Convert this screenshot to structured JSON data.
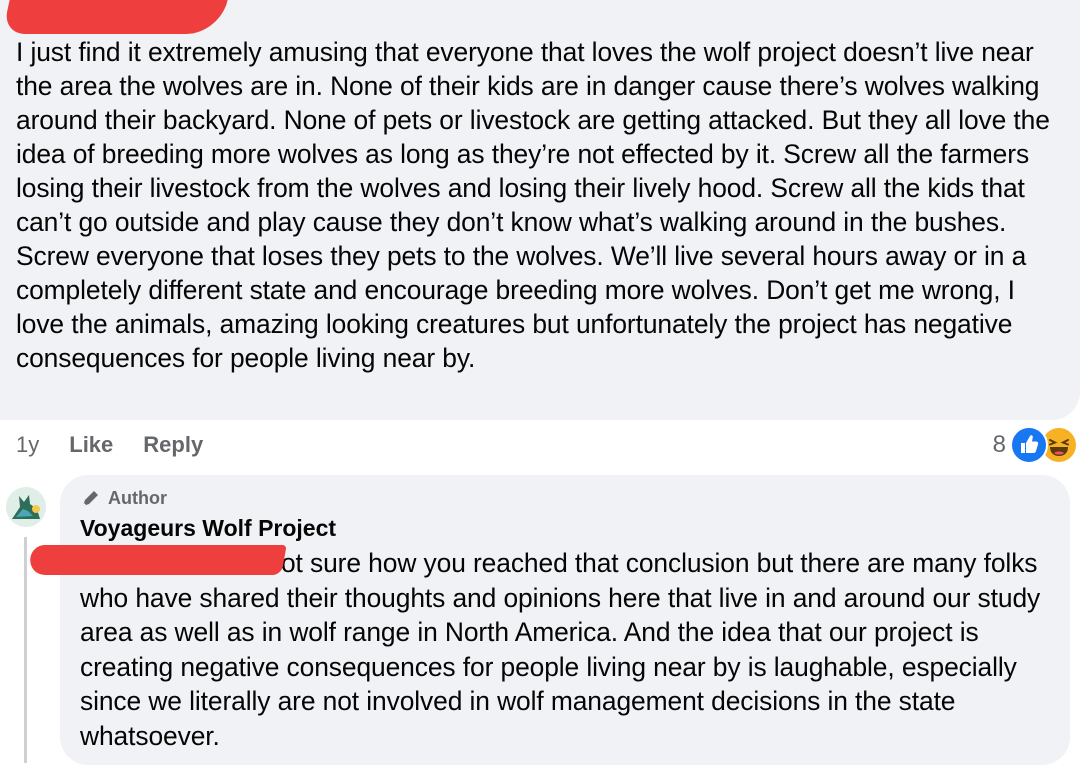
{
  "comment": {
    "text": "I just find it extremely amusing that everyone that loves the wolf project doesn’t live near the area the wolves are in. None of their kids are in danger cause there’s wolves walking around their backyard. None of pets or livestock are getting attacked. But they all love the idea of breeding more wolves as long as they’re not effected by it. Screw all the farmers losing their livestock from the wolves and losing their lively hood. Screw all the kids that can’t go outside and play cause they don’t know what’s walking around in the bushes. Screw everyone that loses they pets to the wolves. We’ll live several hours away or in a completely different state and encourage breeding more wolves. Don’t get me wrong, I love the animals, amazing looking creatures but unfortunately the project has negative consequences for people living near by.",
    "age": "1y",
    "like_label": "Like",
    "reply_label": "Reply",
    "reaction_count": "8",
    "reaction_icons": [
      "like-icon",
      "haha-icon"
    ]
  },
  "reply": {
    "badge": "Author",
    "badge_icon": "pen-icon",
    "author": "Voyageurs Wolf Project",
    "text": "Not sure how you reached that conclusion but there are many folks who have shared their thoughts and opinions here that live in and around our study area as well as in wolf range in North America. And the idea that our project is creating negative consequences for people living near by is laughable, especially since we literally are not involved in wolf management decisions in the state whatsoever."
  },
  "colors": {
    "bubble": "#f0f2f5",
    "muted_text": "#65676b",
    "like_blue": "#1877f2",
    "haha_yellow": "#f7b125",
    "redaction": "#ef3e3e"
  }
}
